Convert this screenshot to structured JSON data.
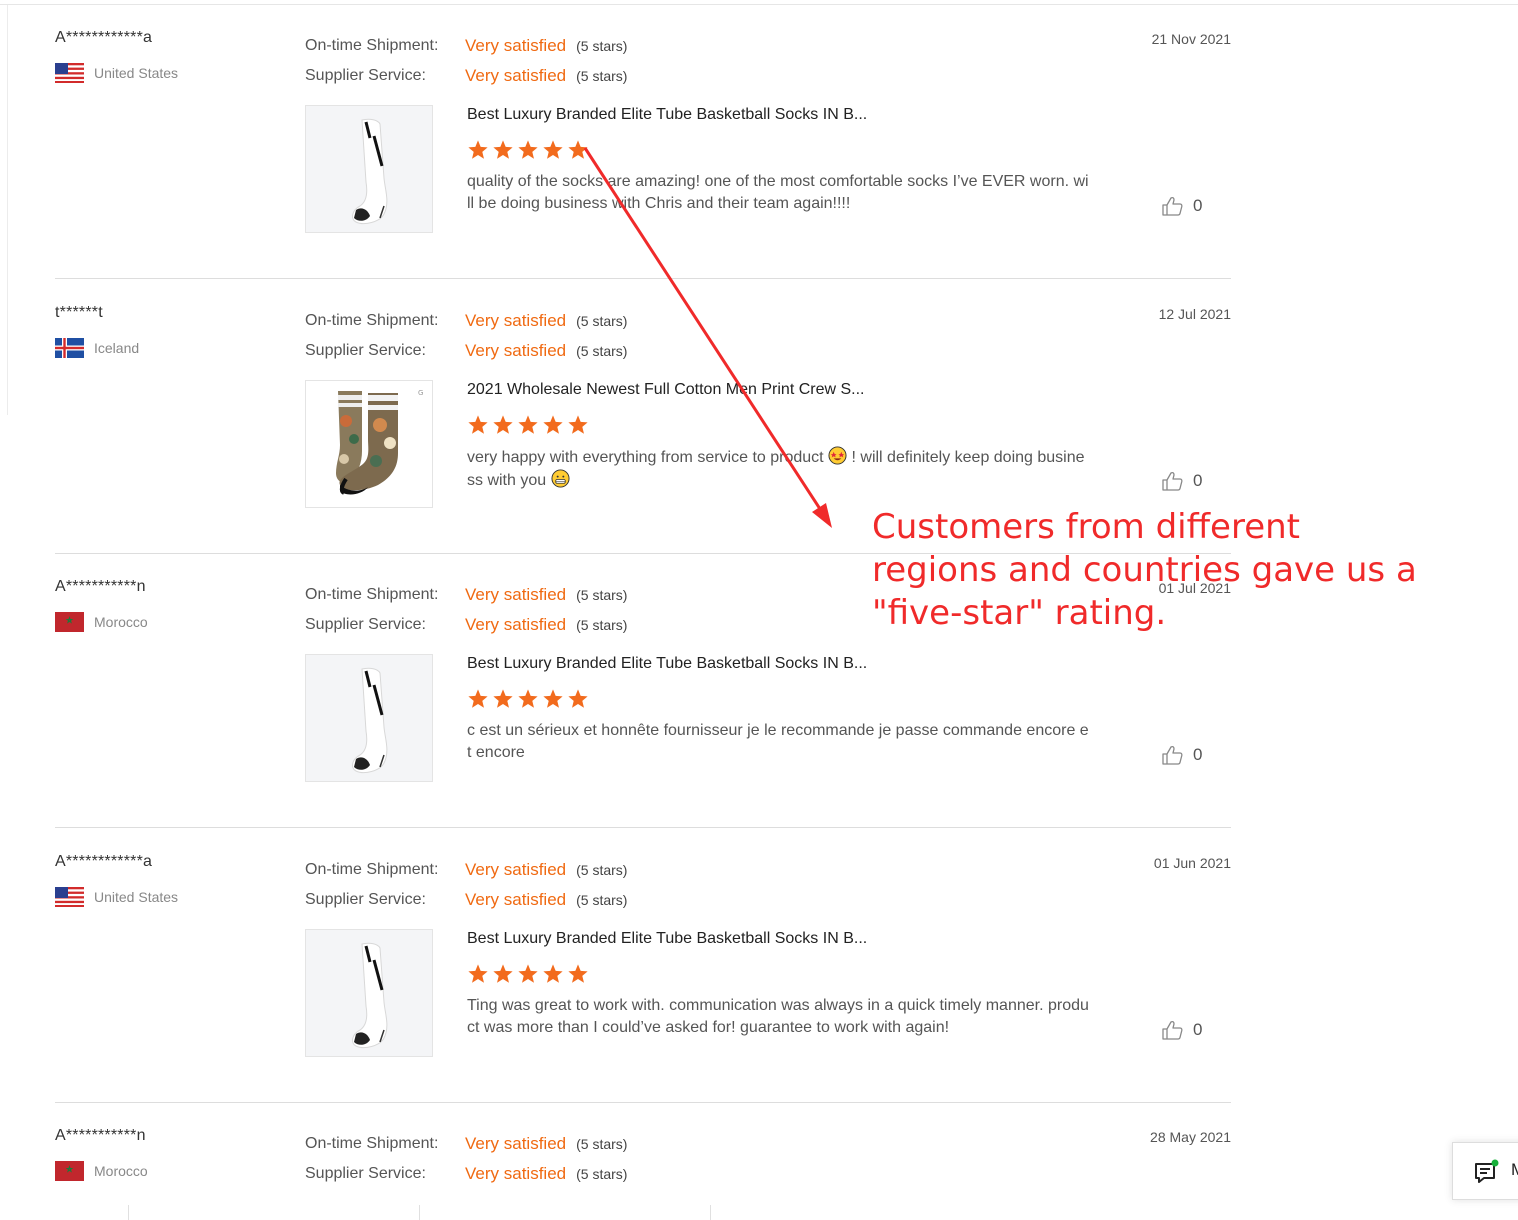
{
  "reviews": [
    {
      "buyer": "A************a",
      "country": "United States",
      "flag": "us",
      "shipment_label": "On-time Shipment:",
      "shipment_value": "Very satisfied",
      "shipment_stars": "(5 stars)",
      "service_label": "Supplier Service:",
      "service_value": "Very satisfied",
      "service_stars": "(5 stars)",
      "date": "21 Nov 2021",
      "product_title": "Best Luxury Branded Elite Tube Basketball Socks IN B...",
      "product_image": "white-sock",
      "stars": 5,
      "comment": "quality of the socks are amazing! one of the most comfortable socks I’ve EVER worn. will be doing business with Chris and their team again!!!!",
      "likes": "0"
    },
    {
      "buyer": "t******t",
      "country": "Iceland",
      "flag": "is",
      "shipment_label": "On-time Shipment:",
      "shipment_value": "Very satisfied",
      "shipment_stars": "(5 stars)",
      "service_label": "Supplier Service:",
      "service_value": "Very satisfied",
      "service_stars": "(5 stars)",
      "date": "12 Jul 2021",
      "product_title": "2021 Wholesale Newest Full Cotton Men Print Crew S...",
      "product_image": "printed-sock",
      "stars": 5,
      "comment_parts": [
        "very happy with everything from service to product ",
        " ! will definitely keep doing business with you "
      ],
      "likes": "0"
    },
    {
      "buyer": "A***********n",
      "country": "Morocco",
      "flag": "ma",
      "shipment_label": "On-time Shipment:",
      "shipment_value": "Very satisfied",
      "shipment_stars": "(5 stars)",
      "service_label": "Supplier Service:",
      "service_value": "Very satisfied",
      "service_stars": "(5 stars)",
      "date": "01 Jul 2021",
      "product_title": "Best Luxury Branded Elite Tube Basketball Socks IN B...",
      "product_image": "white-sock",
      "stars": 5,
      "comment": "c est un sérieux et honnête fournisseur je le recommande je passe commande encore et encore",
      "likes": "0"
    },
    {
      "buyer": "A************a",
      "country": "United States",
      "flag": "us",
      "shipment_label": "On-time Shipment:",
      "shipment_value": "Very satisfied",
      "shipment_stars": "(5 stars)",
      "service_label": "Supplier Service:",
      "service_value": "Very satisfied",
      "service_stars": "(5 stars)",
      "date": "01 Jun 2021",
      "product_title": "Best Luxury Branded Elite Tube Basketball Socks IN B...",
      "product_image": "white-sock",
      "stars": 5,
      "comment": "Ting was great to work with. communication was always in a quick timely manner. product was more than I could’ve asked for! guarantee to work with again!",
      "likes": "0"
    },
    {
      "buyer": "A***********n",
      "country": "Morocco",
      "flag": "ma",
      "shipment_label": "On-time Shipment:",
      "shipment_value": "Very satisfied",
      "shipment_stars": "(5 stars)",
      "service_label": "Supplier Service:",
      "service_value": "Very satisfied",
      "service_stars": "(5 stars)",
      "date": "28 May 2021"
    }
  ],
  "annotation": {
    "text": "Customers from different regions and countries gave us a \"five-star\" rating.",
    "color": "#f02a2a"
  },
  "chat_widget": {
    "icon": "message-icon",
    "label": "M"
  },
  "colors": {
    "accent_orange": "#f06a12",
    "star": "#f26b1d",
    "annotation_red": "#f02a2a"
  }
}
